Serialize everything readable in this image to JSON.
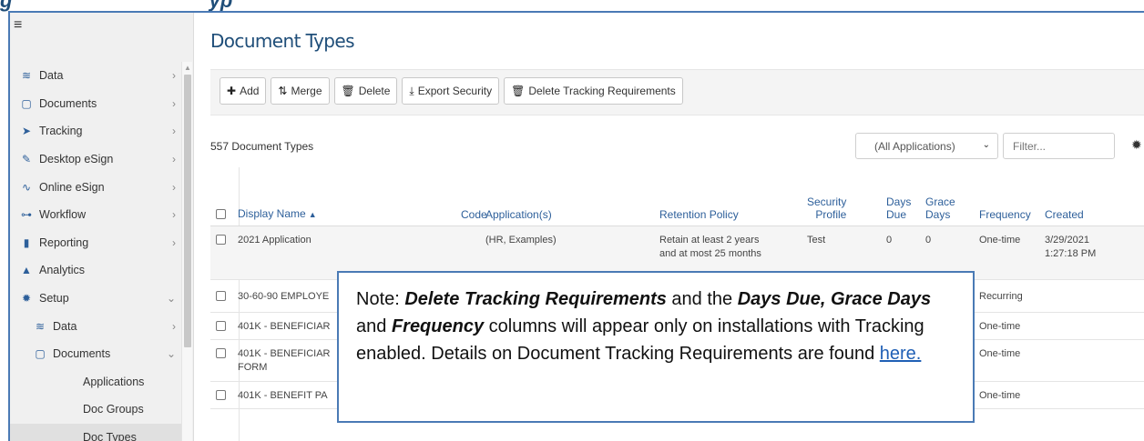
{
  "doc_heading": {
    "part1": "g",
    "part2": "  ",
    "part3": "y",
    "part4": "p"
  },
  "sidebar": {
    "hamburger": "≡",
    "items": [
      {
        "label": "Data",
        "icon": "database-icon",
        "glyph": "≋",
        "chevron": "›"
      },
      {
        "label": "Documents",
        "icon": "clipboard-icon",
        "glyph": "▢",
        "chevron": "›"
      },
      {
        "label": "Tracking",
        "icon": "paper-plane-icon",
        "glyph": "➤",
        "chevron": "›"
      },
      {
        "label": "Desktop eSign",
        "icon": "pen-icon",
        "glyph": "✎",
        "chevron": "›"
      },
      {
        "label": "Online eSign",
        "icon": "signature-icon",
        "glyph": "∿",
        "chevron": "›"
      },
      {
        "label": "Workflow",
        "icon": "sitemap-icon",
        "glyph": "⊶",
        "chevron": "›"
      },
      {
        "label": "Reporting",
        "icon": "file-icon",
        "glyph": "▮",
        "chevron": "›"
      },
      {
        "label": "Analytics",
        "icon": "area-chart-icon",
        "glyph": "▲",
        "chevron": ""
      },
      {
        "label": "Setup",
        "icon": "cog-icon",
        "glyph": "✹",
        "chevron": "⌄"
      },
      {
        "label": "Data",
        "icon": "database-icon",
        "glyph": "≋",
        "chevron": "›"
      },
      {
        "label": "Documents",
        "icon": "clipboard-icon",
        "glyph": "▢",
        "chevron": "⌄"
      },
      {
        "label": "Applications"
      },
      {
        "label": "Doc Groups"
      },
      {
        "label": "Doc Types"
      }
    ]
  },
  "main": {
    "title": "Document Types",
    "toolbar": {
      "add": "Add",
      "merge": "Merge",
      "delete": "Delete",
      "export_security": "Export Security",
      "delete_tracking": "Delete Tracking Requirements"
    },
    "count": "557 Document Types",
    "app_filter": "(All Applications)",
    "filter_placeholder": "Filter...",
    "columns": {
      "display_name": "Display Name",
      "code": "Code",
      "applications": "Application(s)",
      "retention": "Retention Policy",
      "security_1": "Security",
      "security_2": "Profile",
      "days_due_1": "Days",
      "days_due_2": "Due",
      "grace_1": "Grace",
      "grace_2": "Days",
      "frequency": "Frequency",
      "created": "Created"
    },
    "rows": [
      {
        "name": "2021 Application",
        "code": "",
        "apps": "(HR, Examples)",
        "retention_1": "Retain at least 2 years",
        "retention_2": "and at most 25 months",
        "security": "Test",
        "days_due": "0",
        "grace": "0",
        "frequency": "One-time",
        "created_1": "3/29/2021",
        "created_2": "1:27:18 PM"
      },
      {
        "name": "30-60-90 EMPLOYE",
        "name_2": "",
        "frequency": "Recurring"
      },
      {
        "name": "401K - BENEFICIAR",
        "name_2": "",
        "frequency": "One-time"
      },
      {
        "name": "401K - BENEFICIAR",
        "name_2": "FORM",
        "frequency": "One-time"
      },
      {
        "name": "401K - BENEFIT PA",
        "name_2": "",
        "frequency": "One-time"
      }
    ]
  },
  "note": {
    "lead": "Note:  ",
    "b1": "Delete Tracking Requirements",
    "t1": " and the ",
    "b2": "Days Due, Grace Days",
    "t2": " and ",
    "b3": "Frequency",
    "t3": " columns  will appear only on installations with Tracking enabled. Details on Document Tracking Requirements are found ",
    "link": "here."
  }
}
